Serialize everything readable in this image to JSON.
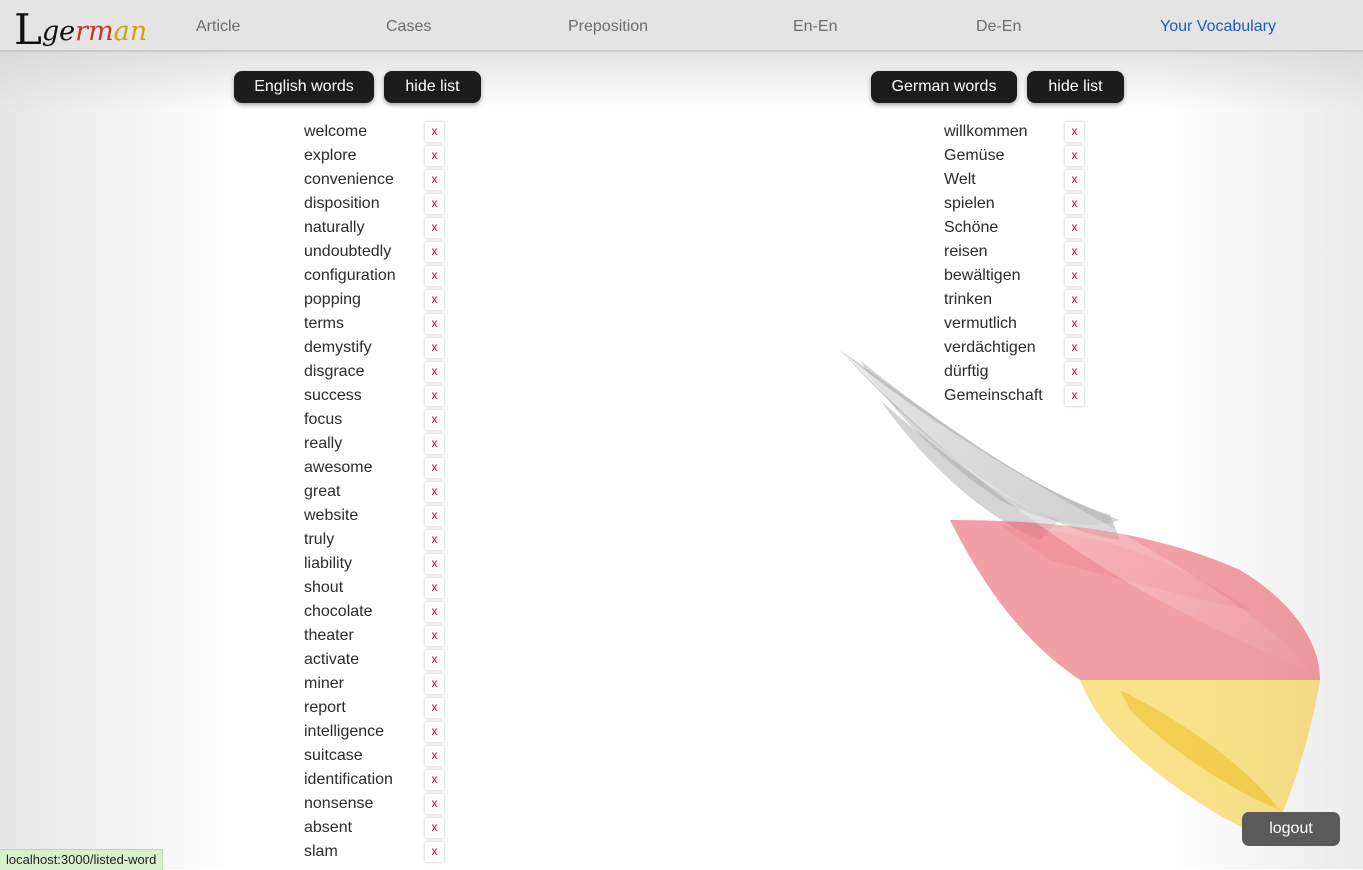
{
  "nav": {
    "logo": {
      "l": "L",
      "part1": "ge",
      "part2": "rm",
      "part3": "an"
    },
    "links": [
      "Article",
      "Cases",
      "Preposition",
      "En-En",
      "De-En",
      "Your Vocabulary"
    ]
  },
  "english": {
    "title": "English words",
    "hide_label": "hide list",
    "words": [
      "welcome",
      "explore",
      "convenience",
      "disposition",
      "naturally",
      "undoubtedly",
      "configuration",
      "popping",
      "terms",
      "demystify",
      "disgrace",
      "success",
      "focus",
      "really",
      "awesome",
      "great",
      "website",
      "truly",
      "liability",
      "shout",
      "chocolate",
      "theater",
      "activate",
      "miner",
      "report",
      "intelligence",
      "suitcase",
      "identification",
      "nonsense",
      "absent",
      "slam"
    ]
  },
  "german": {
    "title": "German words",
    "hide_label": "hide list",
    "words": [
      "willkommen",
      "Gemüse",
      "Welt",
      "spielen",
      "Schöne",
      "reisen",
      "bewältigen",
      "trinken",
      "vermutlich",
      "verdächtigen",
      "dürftig",
      "Gemeinschaft"
    ]
  },
  "delete_label": "x",
  "logout_label": "logout",
  "status_url": "localhost:3000/listed-word",
  "colors": {
    "active_link": "#1a5bc4",
    "delete_x": "#d0021b",
    "button_dark": "#1c1c1c",
    "flag_black": "#9a9a9a",
    "flag_red": "#e8505b",
    "flag_gold": "#f5c518"
  }
}
